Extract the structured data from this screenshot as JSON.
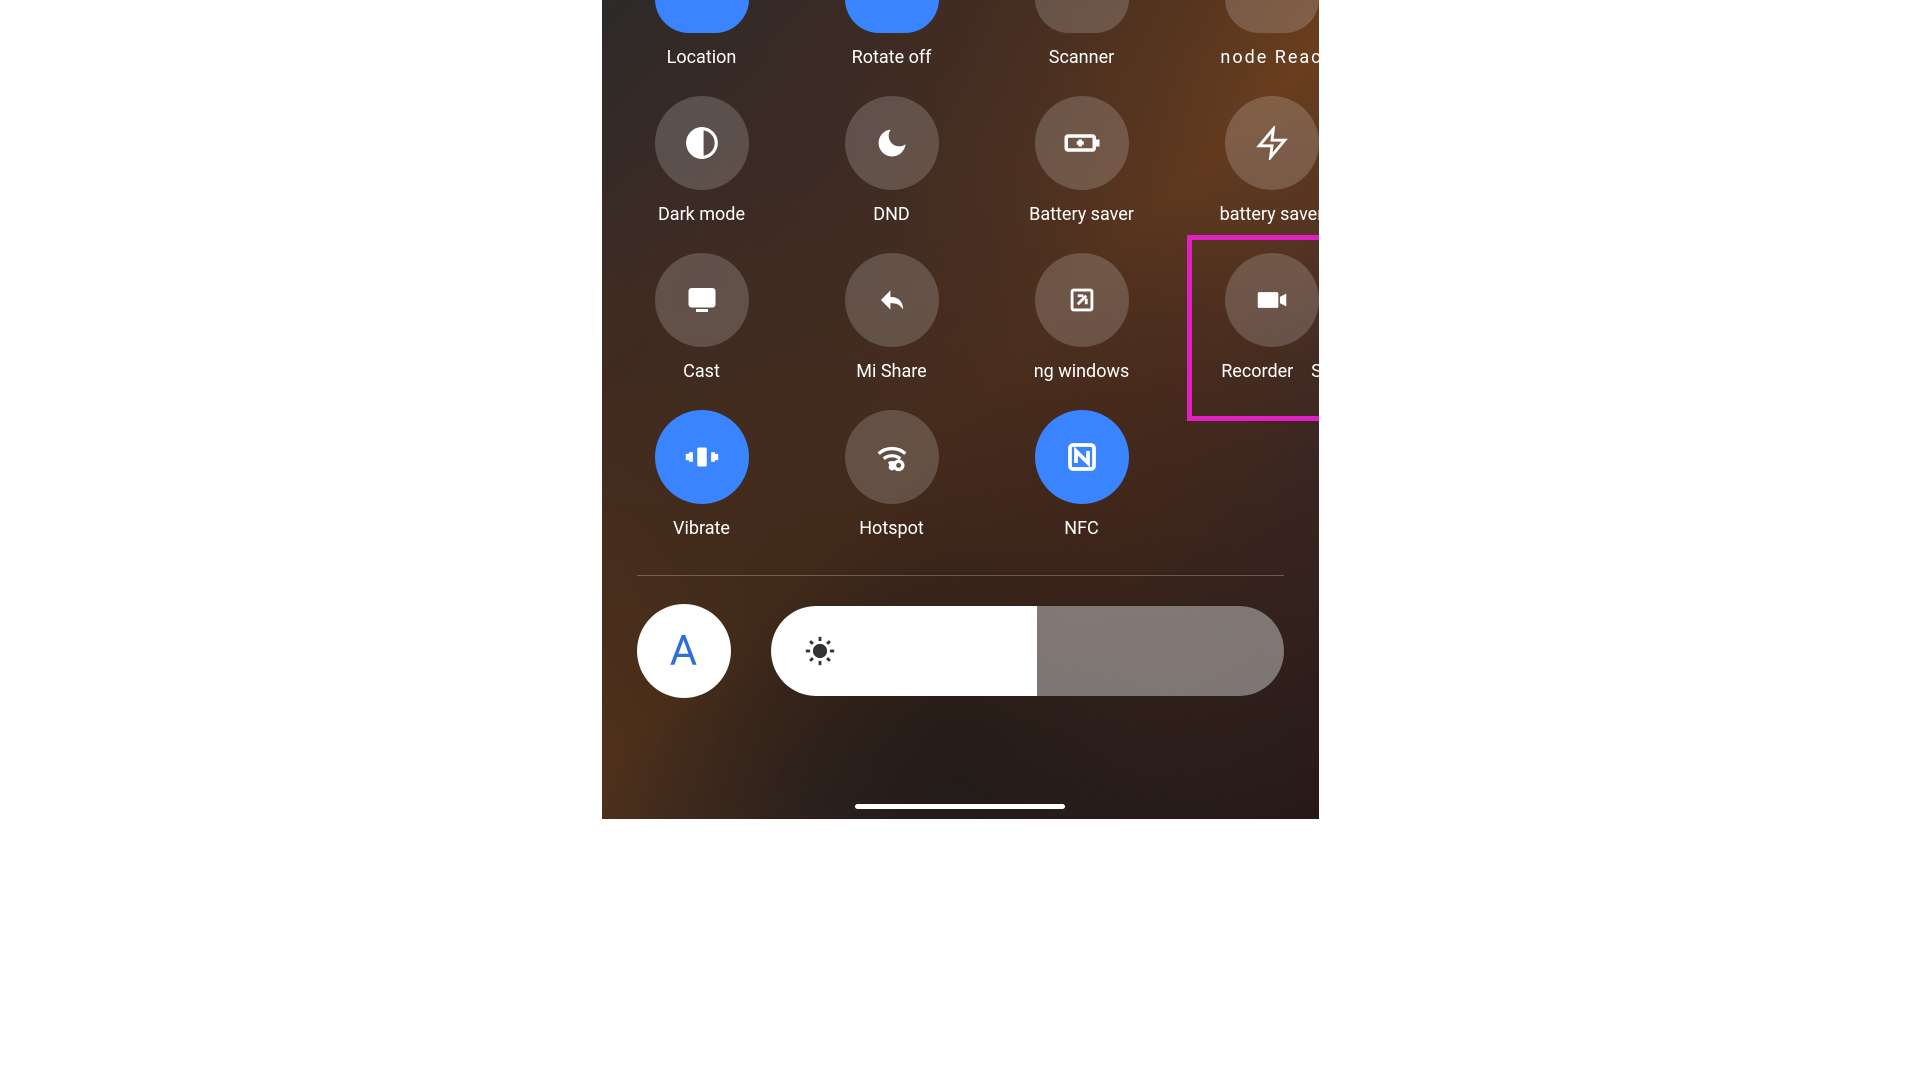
{
  "tiles": {
    "row0": [
      {
        "key": "location",
        "label": "Location",
        "active": true
      },
      {
        "key": "rotate",
        "label": "Rotate off",
        "active": true
      },
      {
        "key": "scanner",
        "label": "Scanner",
        "active": false
      },
      {
        "key": "mode-read",
        "label": "node   Reac",
        "active": false,
        "truncated": true
      }
    ],
    "row1": [
      {
        "key": "darkmode",
        "label": "Dark mode",
        "active": false
      },
      {
        "key": "dnd",
        "label": "DND",
        "active": false
      },
      {
        "key": "battery-saver",
        "label": "Battery saver",
        "active": false
      },
      {
        "key": "super-battery",
        "label": "battery saver",
        "active": false
      }
    ],
    "row2": [
      {
        "key": "cast",
        "label": "Cast",
        "active": false
      },
      {
        "key": "mishare",
        "label": "Mi Share",
        "active": false
      },
      {
        "key": "floating-windows",
        "label": "ng windows",
        "active": false,
        "truncated": true
      },
      {
        "key": "recorder",
        "label": "Recorder    S",
        "active": false,
        "truncated": true,
        "highlighted": true
      }
    ],
    "row3": [
      {
        "key": "vibrate",
        "label": "Vibrate",
        "active": true
      },
      {
        "key": "hotspot",
        "label": "Hotspot",
        "active": false
      },
      {
        "key": "nfc",
        "label": "NFC",
        "active": true
      }
    ]
  },
  "auto_brightness_label": "A",
  "brightness_percent": 52,
  "colors": {
    "active": "#3a84ff",
    "highlight": "#e020c0"
  }
}
